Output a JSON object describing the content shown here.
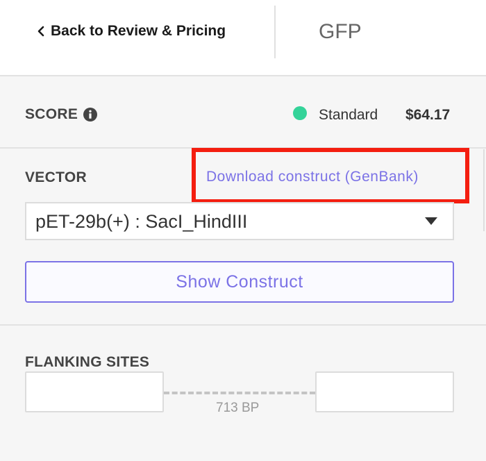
{
  "header": {
    "back_label": "Back to Review & Pricing",
    "title": "GFP"
  },
  "score": {
    "label": "SCORE",
    "status": "Standard",
    "status_color": "#34d399",
    "price": "$64.17"
  },
  "vector": {
    "label": "VECTOR",
    "download_label": "Download construct (GenBank)",
    "selected": "pET-29b(+) : SacI_HindIII",
    "show_button": "Show Construct"
  },
  "flanking": {
    "label": "FLANKING SITES",
    "left_value": "",
    "right_value": "",
    "length": "713 BP"
  },
  "colors": {
    "accent": "#7b72e6",
    "highlight": "#f41e10"
  }
}
